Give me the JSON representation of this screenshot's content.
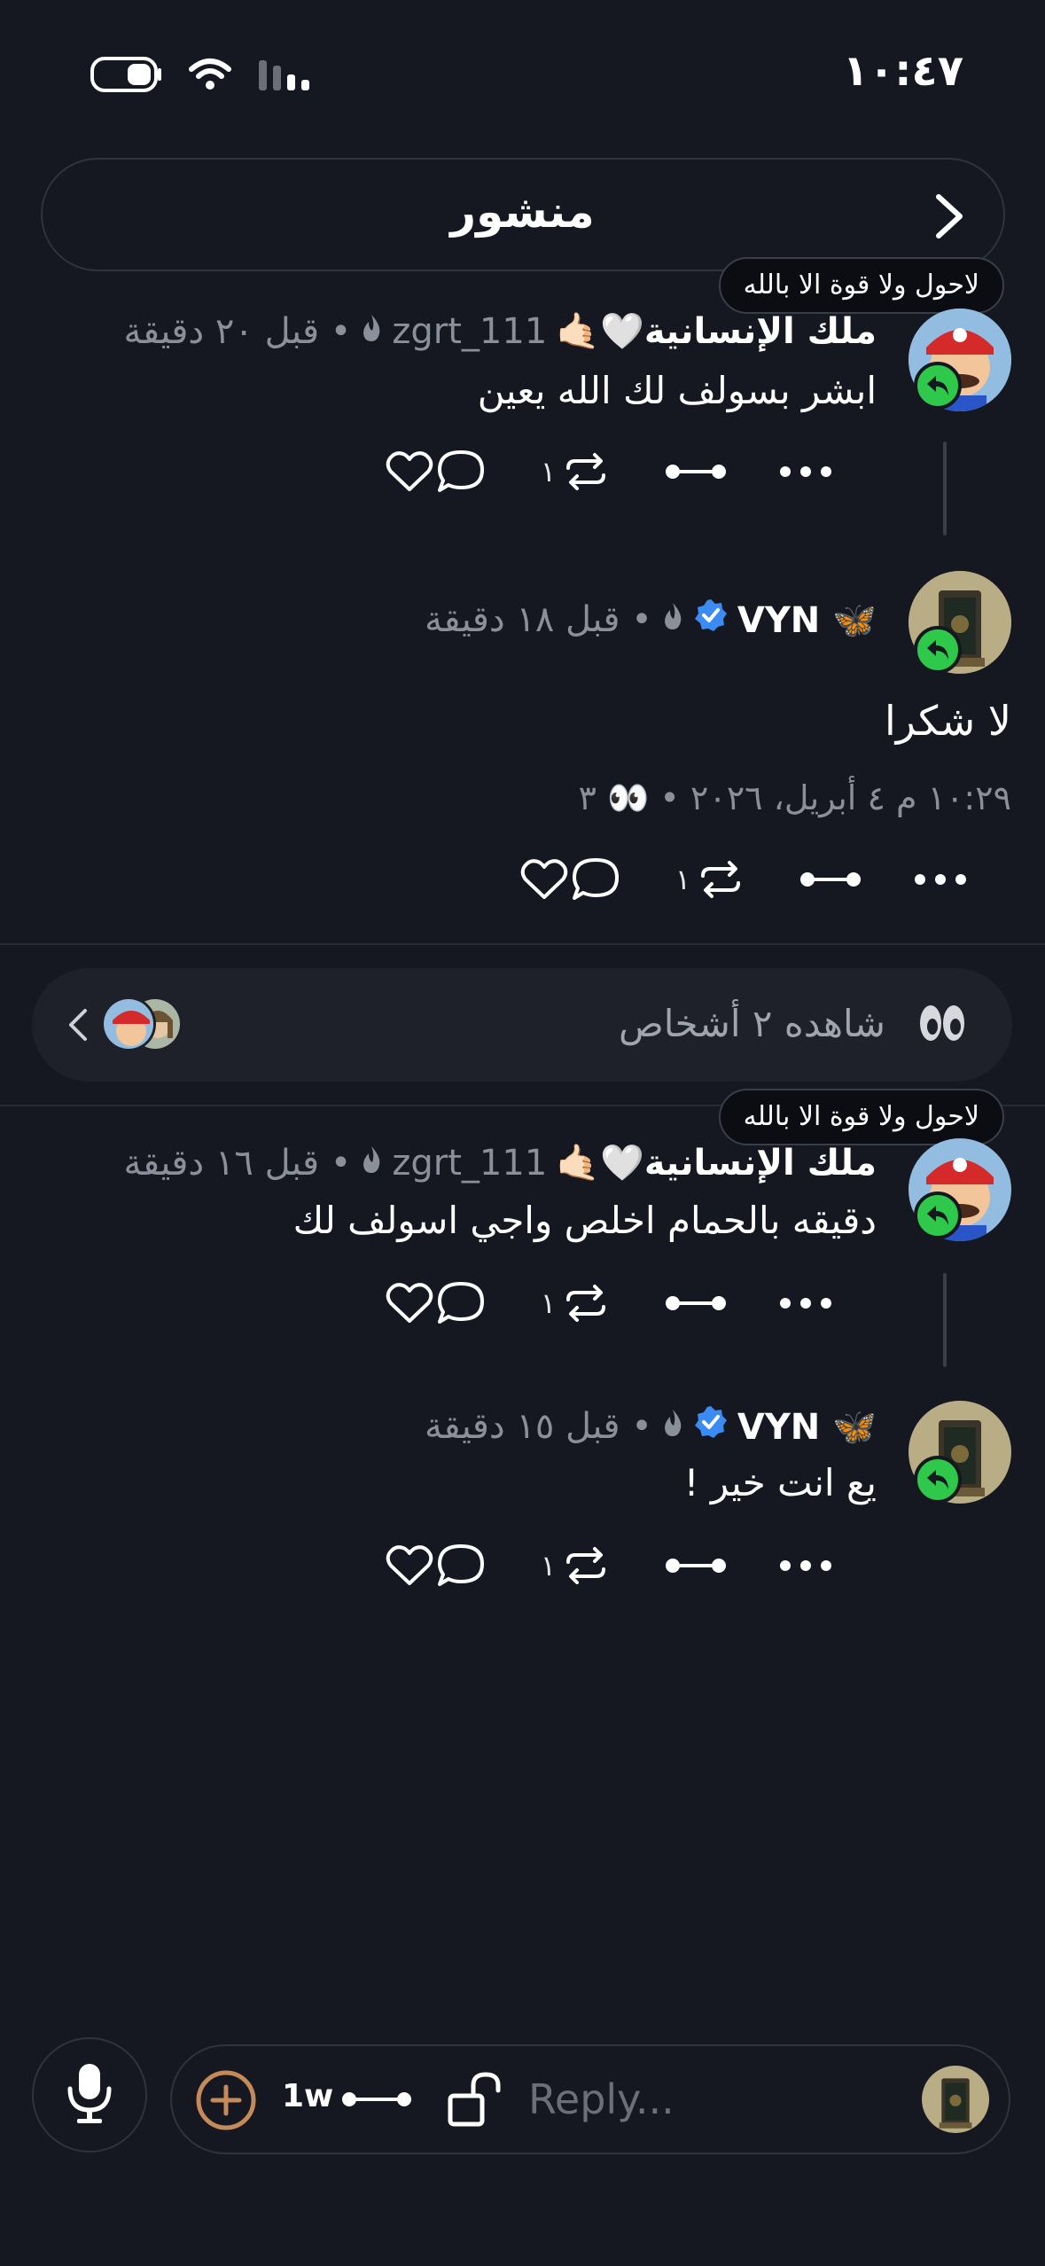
{
  "status": {
    "time": "١٠:٤٧"
  },
  "header": {
    "title": "منشور"
  },
  "tooltip_text": "لاحول ولا قوة الا بالله",
  "posts": [
    {
      "author": "ملك الإنسانية🤍🤙🏻",
      "handle": "zgrt_111",
      "time_ago": "• قبل ٢٠ دقيقة",
      "text": "ابشر بسولف لك الله يعين",
      "comment_count": "١"
    },
    {
      "author": "🦋 VYN",
      "handle": "",
      "time_ago": "• قبل ١٨ دقيقة",
      "text": "لا شكرا",
      "meta": "١٠:٢٩ م ٤ أبريل، ٢٠٢٦ • 👀 ٣",
      "comment_count": "١"
    },
    {
      "author": "ملك الإنسانية🤍🤙🏻",
      "handle": "zgrt_111",
      "time_ago": "• قبل ١٦ دقيقة",
      "text": "دقيقه بالحمام اخلص واجي اسولف لك",
      "comment_count": "١"
    },
    {
      "author": "🦋 VYN",
      "handle": "",
      "time_ago": "• قبل ١٥ دقيقة",
      "text": "يع انت خير !",
      "comment_count": "١"
    }
  ],
  "viewed": {
    "label": "شاهده ٢ أشخاص"
  },
  "composer": {
    "placeholder": "Reply...",
    "expiry_label": "1w"
  },
  "colors": {
    "background": "#151821",
    "reply_badge": "#2ec84a",
    "verified": "#3b8bf5",
    "butterfly": "#4aa3ff",
    "plus_icon": "#c48a5a"
  }
}
